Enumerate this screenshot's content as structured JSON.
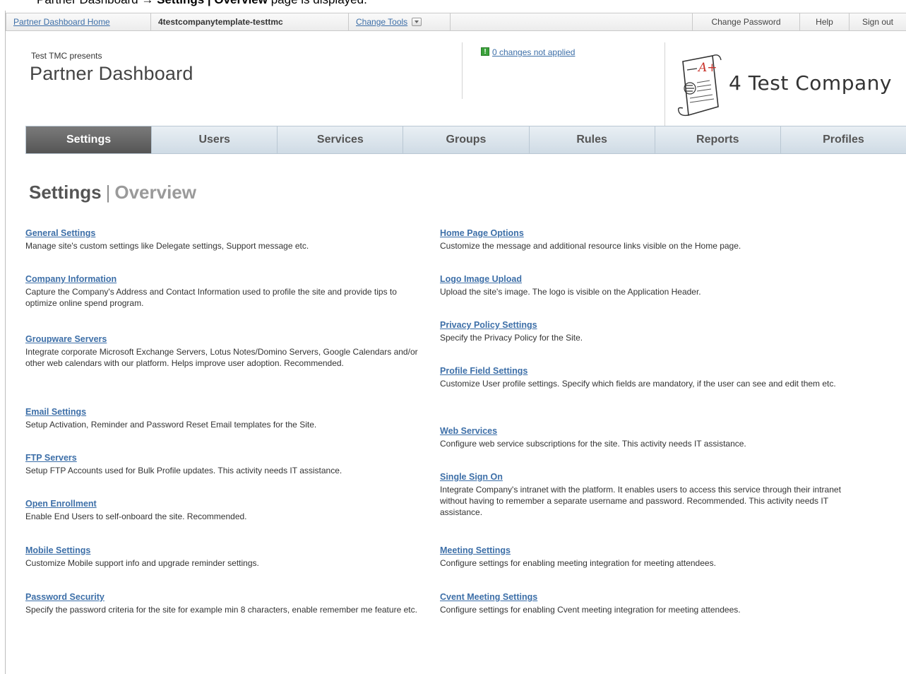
{
  "caption": {
    "prefix": "Partner Dashboard ",
    "arrow": "→",
    "bold": "Settings | Overview",
    "suffix": " page is displayed."
  },
  "topbar": {
    "home_link": "Partner Dashboard Home",
    "company": "4testcompanytemplate-testtmc",
    "change_tools": "Change Tools",
    "change_password": "Change Password",
    "help": "Help",
    "sign_out": "Sign out"
  },
  "header": {
    "presents": "Test TMC presents",
    "title": "Partner Dashboard",
    "changes_icon": "!",
    "changes_link": "0 changes not applied",
    "logo_text": "4 Test Company"
  },
  "tabs": [
    {
      "label": "Settings"
    },
    {
      "label": "Users"
    },
    {
      "label": "Services"
    },
    {
      "label": "Groups"
    },
    {
      "label": "Rules"
    },
    {
      "label": "Reports"
    },
    {
      "label": "Profiles"
    }
  ],
  "page": {
    "title": "Settings",
    "separator": "|",
    "subtitle": "Overview"
  },
  "left_items": [
    {
      "title": "General Settings",
      "desc": "Manage site's custom settings like Delegate settings, Support message etc."
    },
    {
      "title": "Company Information",
      "desc": "Capture the Company's Address and Contact Information used to profile the site and provide tips to optimize online spend program."
    },
    {
      "title": "Groupware Servers",
      "desc": "Integrate corporate Microsoft Exchange Servers, Lotus Notes/Domino Servers, Google Calendars and/or other web calendars with our platform. Helps improve user adoption. Recommended."
    },
    {
      "title": "Email Settings",
      "desc": "Setup Activation, Reminder and Password Reset Email templates for the Site."
    },
    {
      "title": "FTP Servers",
      "desc": "Setup FTP Accounts used for Bulk Profile updates. This activity needs IT assistance."
    },
    {
      "title": "Open Enrollment",
      "desc": "Enable End Users to self-onboard the site. Recommended."
    },
    {
      "title": "Mobile Settings",
      "desc": "Customize Mobile support info and upgrade reminder settings."
    },
    {
      "title": "Password Security",
      "desc": "Specify the password criteria for the site for example min 8 characters, enable remember me feature etc."
    }
  ],
  "right_items": [
    {
      "title": "Home Page Options",
      "desc": "Customize the message and additional resource links visible on the Home page."
    },
    {
      "title": "Logo Image Upload",
      "desc": "Upload the site's image. The logo is visible on the Application Header."
    },
    {
      "title": "Privacy Policy Settings",
      "desc": "Specify the Privacy Policy for the Site."
    },
    {
      "title": "Profile Field Settings",
      "desc": "Customize User profile settings. Specify which fields are mandatory, if the user can see and edit them etc."
    },
    {
      "title": "Web Services",
      "desc": "Configure web service subscriptions for the site. This activity needs IT assistance."
    },
    {
      "title": "Single Sign On",
      "desc": "Integrate Company's intranet with the platform. It enables users to access this service through their intranet without having to remember a separate username and password. Recommended. This activity needs IT assistance."
    },
    {
      "title": "Meeting Settings",
      "desc": "Configure settings for enabling meeting integration for meeting attendees."
    },
    {
      "title": "Cvent Meeting Settings",
      "desc": "Configure settings for enabling Cvent meeting integration for meeting attendees."
    }
  ]
}
